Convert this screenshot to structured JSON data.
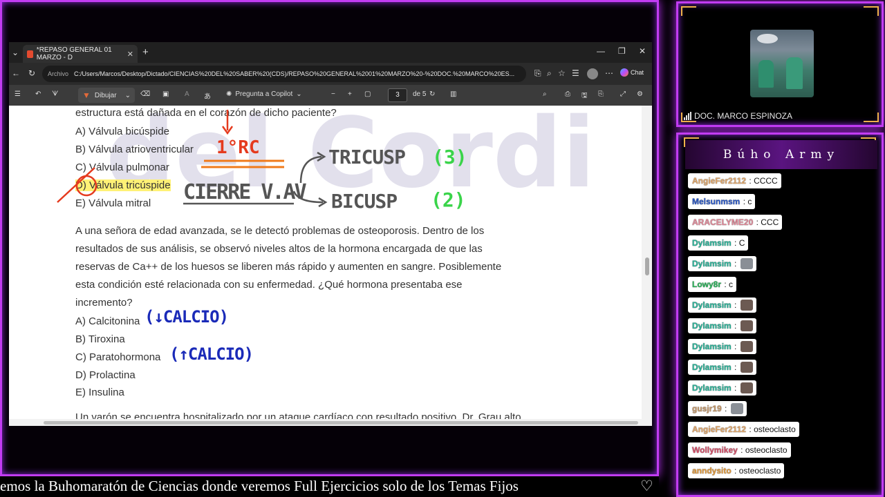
{
  "browser": {
    "tab_title": "*REPASO GENERAL 01 MARZO - D",
    "address_label": "Archivo",
    "url": "C:/Users/Marcos/Desktop/Dictado/CIENCIAS%20DEL%20SABER%20(CDS)/REPASO%20GENERAL%2001%20MARZO%20-%20DOC.%20MARCO%20ES...",
    "chat_label": "Chat"
  },
  "pdf_toolbar": {
    "draw_label": "Dibujar",
    "copilot_label": "Pregunta a Copilot",
    "current_page": "3",
    "page_of": "de 5"
  },
  "document": {
    "q1_tail": "estructura está dañada en el corazón de dicho paciente?",
    "q1_options": [
      "A) Válvula bicúspide",
      "B) Válvula atrioventricular",
      "C) Válvula pulmonar",
      "D) Válvula tricúspide",
      "E) Válvula mitral"
    ],
    "q2_lines": [
      "A una señora de edad avanzada, se le detectó problemas de osteoporosis. Dentro de los",
      "resultados de sus análisis, se observó niveles altos de la hormona encargada de que las",
      "reservas de Ca++ de los huesos se liberen más rápido y aumenten en sangre. Posiblemente",
      "esta condición esté relacionada con su enfermedad. ¿Qué hormona presentaba ese",
      "incremento?"
    ],
    "q2_options": [
      "A) Calcitonina",
      "B) Tiroxina",
      "C) Paratohormona",
      "D) Prolactina",
      "E) Insulina"
    ],
    "q3_partial": "Un varón se encuentra hospitalizado por un ataque cardíaco con resultado positivo. Dr. Grau alto"
  },
  "annotations": {
    "first_sound": "1°RC",
    "valve_closure": "CIERRE V.AV",
    "tricuspid": "TRICUSP",
    "tricuspid_num": "(3)",
    "bicuspid": "BICUSP",
    "bicuspid_num": "(2)",
    "calcitonin_note": "(↓CALCIO)",
    "parathormone_note": "(↑CALCIO)",
    "watermark": "del Cordi",
    "colors": {
      "red": "#e53a1e",
      "orange": "#f07a1a",
      "green": "#3ad44a",
      "blue": "#1a2ab8",
      "gray": "#555555"
    }
  },
  "ticker": {
    "text": "emos la Buhomaratón de Ciencias donde veremos Full Ejercicios solo de los Temas Fijos",
    "heart": "♡"
  },
  "webcam": {
    "name": "DOC. MARCO ESPINOZA"
  },
  "chat": {
    "title": "Búho Army",
    "messages": [
      {
        "user": "AngieFer2112",
        "color": "#e3a86a",
        "text": "CCCC"
      },
      {
        "user": "Melsunmsm",
        "color": "#2a58c8",
        "text": "c"
      },
      {
        "user": "ARACELYME20",
        "color": "#e38a9a",
        "text": "CCC"
      },
      {
        "user": "Dylamsim",
        "color": "#2ab59a",
        "text": "C"
      },
      {
        "user": "Dylamsim",
        "color": "#2ab59a",
        "text": "",
        "emote": "cat"
      },
      {
        "user": "Lowy8r",
        "color": "#2ab55a",
        "text": "c"
      },
      {
        "user": "Dylamsim",
        "color": "#2ab59a",
        "text": "",
        "emote": "face"
      },
      {
        "user": "Dylamsim",
        "color": "#2ab59a",
        "text": "",
        "emote": "face"
      },
      {
        "user": "Dylamsim",
        "color": "#2ab59a",
        "text": "",
        "emote": "face"
      },
      {
        "user": "Dylamsim",
        "color": "#2ab59a",
        "text": "",
        "emote": "face"
      },
      {
        "user": "Dylamsim",
        "color": "#2ab59a",
        "text": "",
        "emote": "face"
      },
      {
        "user": "gusjr19",
        "color": "#c89a6a",
        "text": "",
        "emote": "cat"
      },
      {
        "user": "AngieFer2112",
        "color": "#e3a86a",
        "text": "osteoclasto"
      },
      {
        "user": "Wollymikey",
        "color": "#d8506a",
        "text": "osteoclasto"
      },
      {
        "user": "anndysito",
        "color": "#e39a3a",
        "text": "osteoclasto"
      }
    ]
  }
}
